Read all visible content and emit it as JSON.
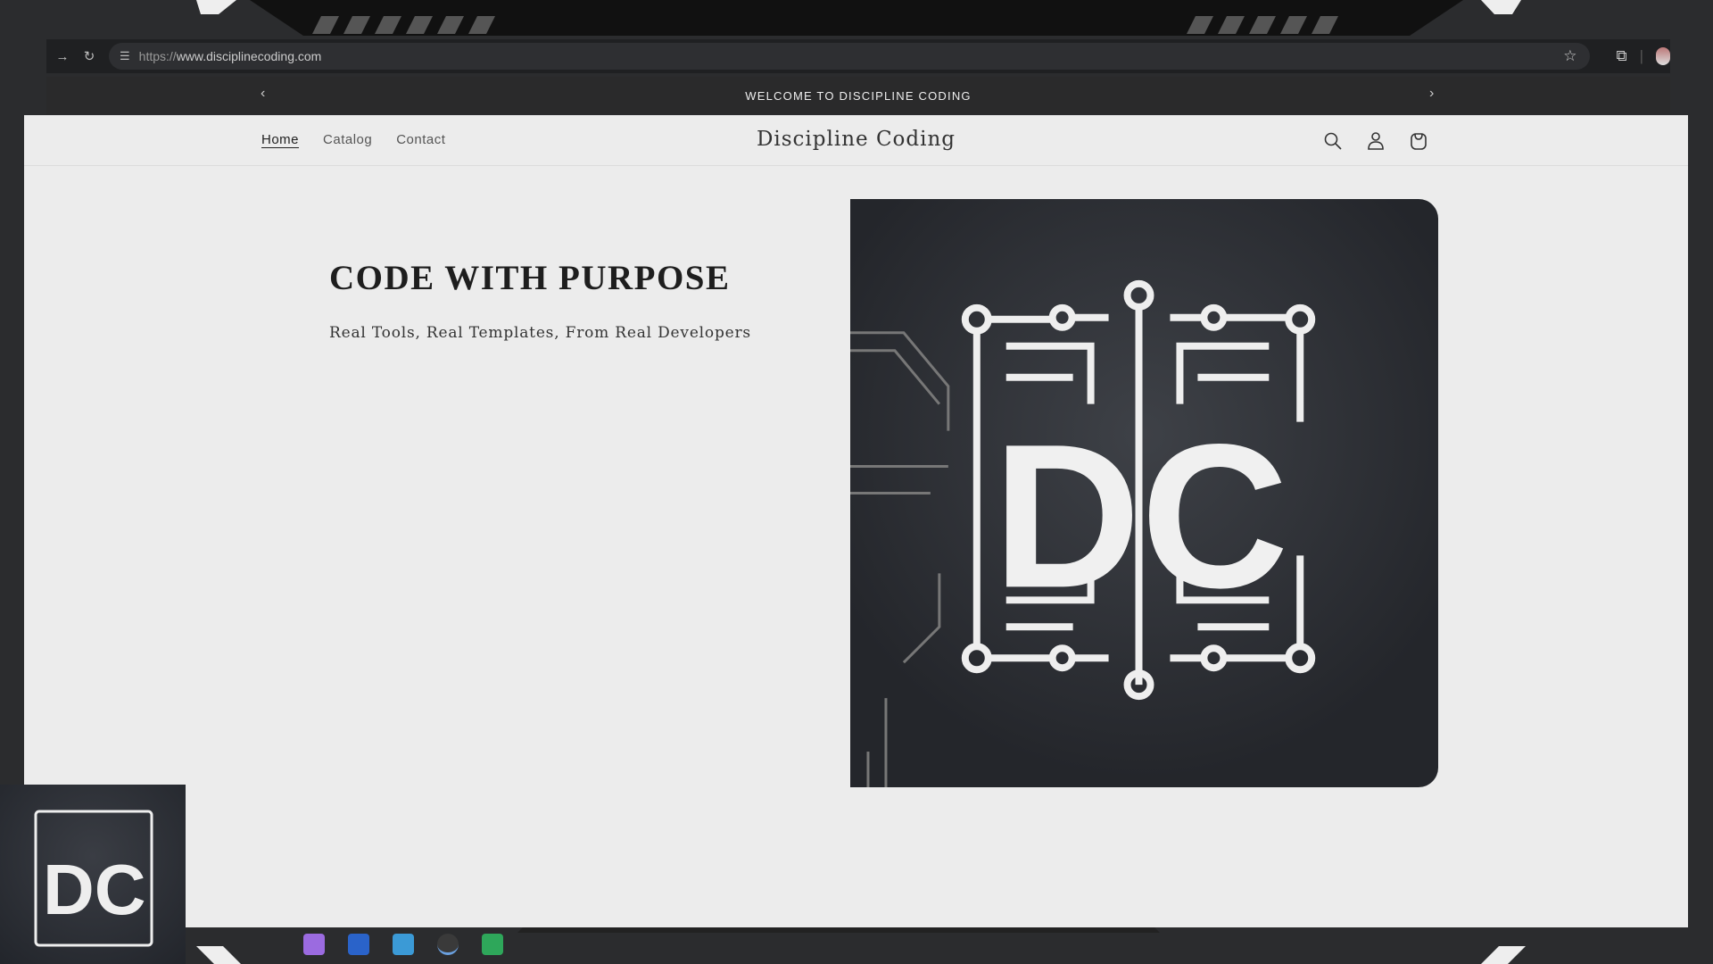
{
  "browser": {
    "url_protocol": "https://",
    "url_host": "www.disciplinecoding.com",
    "icons": [
      "forward-icon",
      "reload-icon",
      "site-settings-icon",
      "bookmark-star-icon",
      "extensions-icon",
      "profile-avatar"
    ]
  },
  "announcement": {
    "text": "WELCOME TO DISCIPLINE CODING",
    "prev": "‹",
    "next": "›"
  },
  "header": {
    "brand": "Discipline Coding",
    "nav": [
      {
        "label": "Home"
      },
      {
        "label": "Catalog"
      },
      {
        "label": "Contact"
      }
    ],
    "icons": [
      "search-icon",
      "account-icon",
      "cart-icon"
    ]
  },
  "hero": {
    "title": "CODE WITH PURPOSE",
    "subtitle": "Real Tools, Real Templates, From Real Developers",
    "logo_text": "DC"
  },
  "colors": {
    "page_bg": "#ececec",
    "announce_bg": "#2a2a2b",
    "frame": "#2b2c2e"
  }
}
